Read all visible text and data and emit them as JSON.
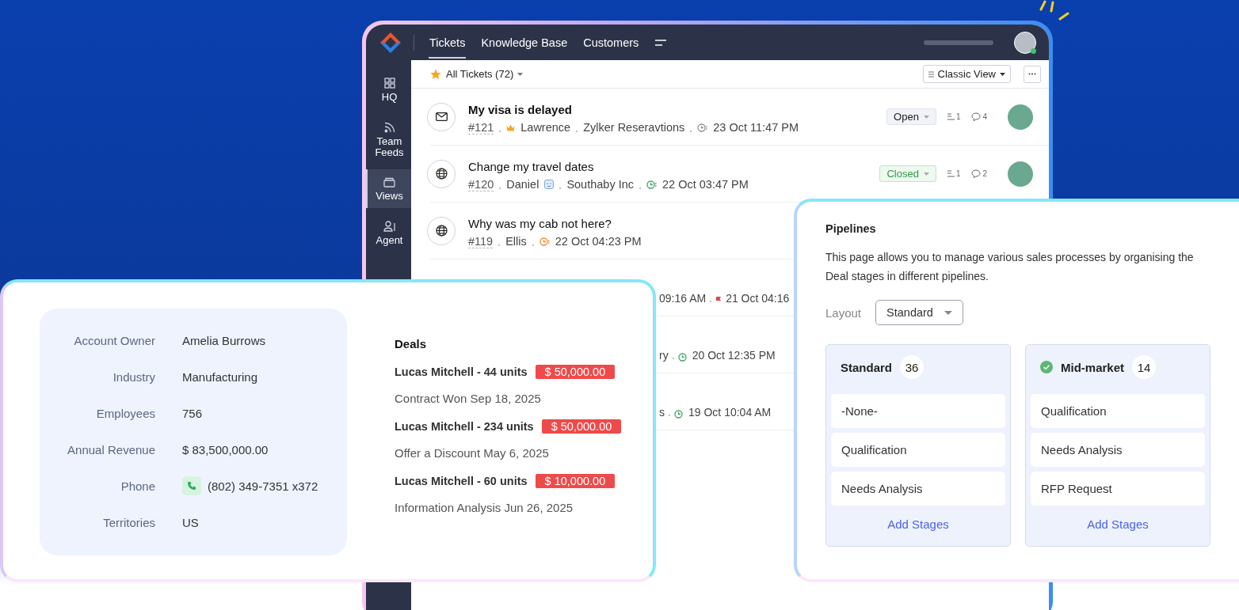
{
  "tickets_window": {
    "nav_tabs": [
      {
        "label": "Tickets",
        "selected": true
      },
      {
        "label": "Knowledge Base",
        "selected": false
      },
      {
        "label": "Customers",
        "selected": false
      }
    ],
    "sidebar": [
      {
        "label": "HQ",
        "kind": "grid",
        "selected": false
      },
      {
        "label": "Team Feeds",
        "kind": "feed",
        "selected": false
      },
      {
        "label": "Views",
        "kind": "tray",
        "selected": true
      },
      {
        "label": "Agent",
        "kind": "agent",
        "selected": false
      }
    ],
    "view_selector": "All Tickets (72)",
    "view_mode": "Classic View",
    "tickets": [
      {
        "kind": "email",
        "title": "My visa is delayed",
        "unread": true,
        "number": "#121",
        "contact": {
          "kind": "vip",
          "name": "Lawrence"
        },
        "account": "Zylker Reseravtions",
        "due": {
          "kind": "normal",
          "time": "23 Oct 11:47 PM"
        },
        "status": {
          "label": "Open",
          "kind": "open"
        },
        "threads": "1",
        "comments": "4"
      },
      {
        "kind": "web",
        "title": "Change my travel dates",
        "unread": false,
        "number": "#120",
        "contact": {
          "kind": "customer",
          "name": "Daniel"
        },
        "account": "Southaby Inc",
        "due": {
          "kind": "ok",
          "time": "22 Oct 03:47 PM"
        },
        "status": {
          "label": "Closed",
          "kind": "closed"
        },
        "threads": "1",
        "comments": "2"
      },
      {
        "kind": "web",
        "title": "Why was my cab not here?",
        "unread": false,
        "number": "#119",
        "contact": {
          "kind": "plain",
          "name": "Ellis"
        },
        "due": {
          "kind": "overdue",
          "time": "22 Oct 04:23 PM"
        }
      }
    ],
    "partial_rows": [
      {
        "fragments": [
          {
            "kind": "text",
            "text": "09:16 AM"
          },
          {
            "kind": "flag",
            "text": "21 Oct 04:16"
          }
        ]
      },
      {
        "fragments": [
          {
            "kind": "text",
            "text": "ry"
          },
          {
            "kind": "clock",
            "text": "20 Oct 12:35 PM"
          }
        ]
      },
      {
        "fragments": [
          {
            "kind": "text",
            "text": "s"
          },
          {
            "kind": "clock",
            "text": "19 Oct 10:04 AM"
          }
        ]
      }
    ]
  },
  "account_card": {
    "fields": [
      {
        "label": "Account Owner",
        "value": "Amelia Burrows",
        "kind": "text"
      },
      {
        "label": "Industry",
        "value": "Manufacturing",
        "kind": "text"
      },
      {
        "label": "Employees",
        "value": "756",
        "kind": "text"
      },
      {
        "label": "Annual Revenue",
        "value": "$ 83,500,000.00",
        "kind": "text"
      },
      {
        "label": "Phone",
        "value": "(802) 349-7351 x372",
        "kind": "phone"
      },
      {
        "label": "Territories",
        "value": "US",
        "kind": "text"
      }
    ],
    "deals_title": "Deals",
    "deals": [
      {
        "name": "Lucas Mitchell - 44 units",
        "amount": "$ 50,000.00",
        "stage": "Contract Won Sep 18, 2025"
      },
      {
        "name": "Lucas Mitchell - 234 units",
        "amount": "$ 50,000.00",
        "stage": "Offer a Discount May 6, 2025"
      },
      {
        "name": "Lucas Mitchell - 60 units",
        "amount": "$ 10,000.00",
        "stage": "Information Analysis Jun 26, 2025"
      }
    ]
  },
  "pipelines_card": {
    "title": "Pipelines",
    "description": "This page allows you to manage various sales processes by organising the Deal stages in different pipelines.",
    "layout_label": "Layout",
    "layout_value": "Standard",
    "pipelines": [
      {
        "name": "Standard",
        "count": "36",
        "default": false,
        "stages": [
          "-None-",
          "Qualification",
          "Needs Analysis"
        ],
        "add_label": "Add Stages"
      },
      {
        "name": "Mid-market",
        "count": "14",
        "default": true,
        "stages": [
          "Qualification",
          "Needs Analysis",
          "RFP Request"
        ],
        "add_label": "Add Stages"
      }
    ]
  }
}
